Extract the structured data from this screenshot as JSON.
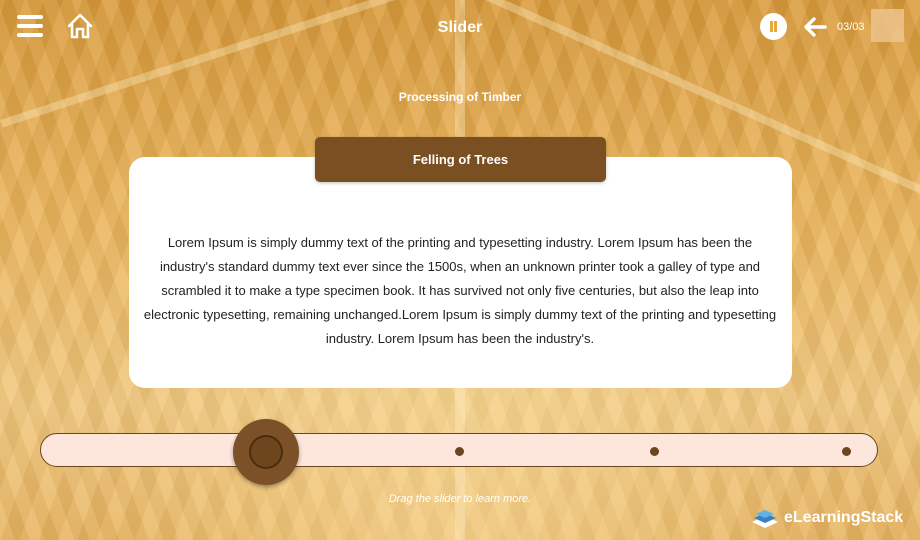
{
  "header": {
    "title": "Slider",
    "page_counter": "03/03"
  },
  "content": {
    "subtitle": "Processing of Timber",
    "card_title": "Felling of Trees",
    "card_text": "Lorem Ipsum is simply dummy text of the printing and typesetting industry. Lorem Ipsum has been the industry's standard dummy text ever since the 1500s, when an unknown printer took a galley of type and scrambled it to make a type specimen book. It has survived not only five centuries, but also the leap into electronic typesetting, remaining unchanged.Lorem Ipsum is simply dummy text of the printing and typesetting industry. Lorem Ipsum has been the industry's."
  },
  "slider": {
    "stops": 4,
    "current_stop": 1,
    "hint": "Drag the slider to learn more."
  },
  "brand": {
    "logo_text": "eLearningStack"
  },
  "colors": {
    "accent": "#7a4f22",
    "pause_icon": "#e8a93c",
    "track": "#fde6dc"
  },
  "icons": {
    "menu": "hamburger-menu-icon",
    "home": "home-icon",
    "pause": "pause-icon",
    "back": "arrow-left-icon"
  }
}
